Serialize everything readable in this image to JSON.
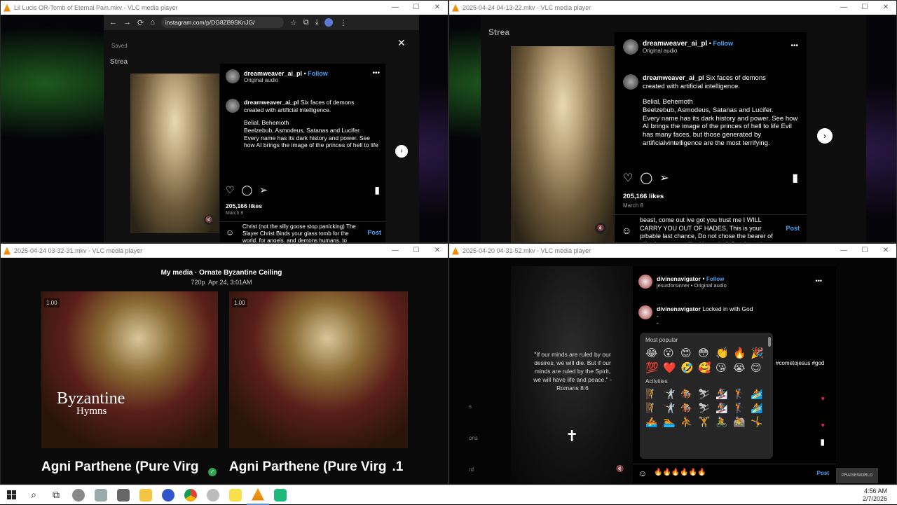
{
  "windows": {
    "tl": {
      "title": "Lil Lucis OR-Tomb of Eternal Pain.mkv - VLC media player"
    },
    "tr": {
      "title": "2025-04-24 04-13-22.mkv - VLC media player"
    },
    "bl": {
      "title": "2025-04-24 03-32-31.mkv - VLC media player"
    },
    "br": {
      "title": "2025-04-20 04-31-52.mkv - VLC media player"
    }
  },
  "window_controls": {
    "min": "—",
    "max": "☐",
    "close": "✕"
  },
  "browser": {
    "url": "instagram.com/p/DG8ZB9SKnJG/",
    "saved": "Saved",
    "stream": "Strea"
  },
  "post": {
    "username": "dreamweaver_ai_pl",
    "follow": "Follow",
    "dot": "•",
    "audio": "Original audio",
    "caption_line1": "Six faces of demons",
    "caption_line2": "created with artificial intelligence.",
    "caption_names1": "Belial, Behemoth",
    "caption_names2": "Beelzebub, Asmodeus, Satanas and Lucifer.",
    "caption_body": "Every name has its dark history and power. See how AI brings the image of the princes of hell to life Evil has many faces, but those generated by artificialvintelligence are the most terrifying.",
    "likes": "205,166 likes",
    "date": "March 8",
    "comment_tl": "Christ (not the silly goose stop panicking) The Slayer Christ Binds your glass tomb for the world, for angels, and demons humans, to witness what happens when you attack The Fathers",
    "comment_tr": "beast, come out ive got you trust me I WILL CARRY YOU OUT OF HADES, This is your prbable last chance, Do not chose the bearer of gifts, he appears like Upper Left Quadrant, but",
    "post": "Post",
    "badge": "DREAM WEAVER"
  },
  "bl": {
    "header_left": "My media",
    "header_sep": "·",
    "header_right": "Ornate Byzantine Ceiling",
    "meta": "720p  Apr 24, 3:01AM",
    "badge": "1.00",
    "overlay_big": "Byzantine",
    "overlay_small": "Hymns",
    "caption_left": "Agni Parthene (Pure Virg",
    "caption_right": "Agni Parthene (Pure Virg",
    "caption_suffix": ".1"
  },
  "br": {
    "username": "divinenavigator",
    "follow": "Follow",
    "dot": "•",
    "sub": "jesusforsinner • Original audio",
    "caption": "Locked in with God",
    "dash1": "-",
    "dash2": "-",
    "hashtags": "#cometojesus #god",
    "quote": "\"If our minds are ruled by our desires, we will die. But if our minds are ruled by the Spirit, we will have life and peace.\" - Romans 8:6",
    "cross": "✝",
    "most_popular": "Most popular",
    "activities": "Activities",
    "emojis_popular": [
      "😂",
      "😮",
      "😍",
      "😳",
      "👏",
      "🔥",
      "🎉",
      "💯",
      "❤️",
      "🤣",
      "🥰",
      "😘",
      "😭",
      "😊"
    ],
    "emojis_activities": [
      "🧗",
      "🤺",
      "🏇",
      "⛷",
      "🏂",
      "🏌",
      "🏄",
      "🧗",
      "🤺",
      "🏇",
      "⛷",
      "🏂",
      "🏌",
      "🏄",
      "🚣",
      "🏊",
      "⛹",
      "🏋",
      "🚴",
      "🚵",
      "🤸"
    ],
    "input_value": "🔥🔥🔥🔥🔥🔥",
    "post": "Post",
    "side": [
      "s",
      "ons",
      "rd"
    ],
    "more": "•••",
    "logo_text": "PRAISEWORLD"
  },
  "taskbar": {
    "time": "4:56 AM",
    "date": "2/7/2026"
  },
  "colors": {
    "accent": "#4aa3f5",
    "vlc_orange": "#f08a0c",
    "heart_red": "#e0245e"
  }
}
